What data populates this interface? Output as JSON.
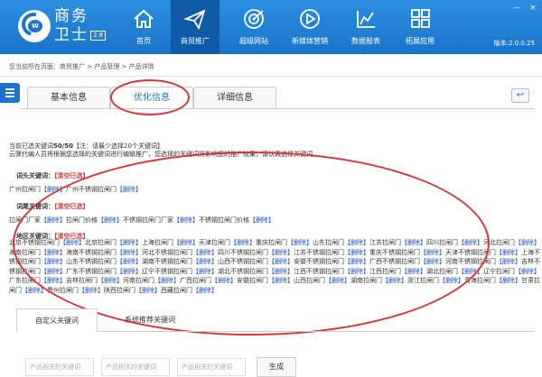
{
  "app": {
    "title": "商务卫士",
    "title_line1": "商务",
    "title_line2": "卫士",
    "version_badge": "2.8",
    "version_text": "版本:2.0.0.25"
  },
  "nav": {
    "items": [
      {
        "label": "首页",
        "icon": "home-icon"
      },
      {
        "label": "商贸推广",
        "icon": "paper-plane-icon"
      },
      {
        "label": "超级网站",
        "icon": "target-icon"
      },
      {
        "label": "新媒体营销",
        "icon": "play-icon"
      },
      {
        "label": "数据报表",
        "icon": "chart-icon"
      },
      {
        "label": "拓展应用",
        "icon": "grid-icon"
      }
    ],
    "active_index": 1
  },
  "window_controls": [
    "—",
    "×"
  ],
  "breadcrumb": "您当前所在页面：商贸推广 > 产品管理 > 产品详情",
  "tabs": [
    {
      "label": "基本信息"
    },
    {
      "label": "优化信息"
    },
    {
      "label": "详细信息"
    }
  ],
  "back_icon": "↩",
  "keywords": {
    "selected_prefix": "当前已选关键词",
    "selected_count": "50/50",
    "selected_suffix": "【注：请最少选择20个关键词】",
    "hint": "云骤代编人员将根据您选择的关键词进行编辑推广，您选择的关键词将影响您的推广效果，请认真选择关键词。",
    "clear_label": "【清空已选】",
    "delete_label": "【删除】",
    "prefix_group": {
      "label": "词头关键词：",
      "items": [
        "广州拉闸门",
        "广州不锈钢拉闸门"
      ]
    },
    "suffix_group": {
      "label": "词尾关键词：",
      "items": [
        "拉闸门厂家",
        "拉闸门价格",
        "不锈钢拉闸门厂家",
        "不锈钢拉闸门价格"
      ]
    },
    "region_group": {
      "label": "地区关键词：",
      "items": [
        "北京不锈钢拉闸门",
        "北京拉闸门",
        "上海拉闸门",
        "天津拉闸门",
        "重庆拉闸门",
        "山东拉闸门",
        "江苏拉闸门",
        "四川拉闸门",
        "河北拉闸门",
        "海南拉闸门",
        "海南不锈钢拉闸门",
        "河北不锈钢拉闸门",
        "四川不锈钢拉闸门",
        "江苏不锈钢拉闸门",
        "重庆不锈钢拉闸门",
        "天津不锈钢拉闸门",
        "上海不锈钢拉闸门",
        "山东不锈钢拉闸门",
        "湖南不锈钢拉闸门",
        "山西不锈钢拉闸门",
        "安徽不锈钢拉闸门",
        "广西不锈钢拉闸门",
        "河南不锈钢拉闸门",
        "吉林不锈钢拉闸门",
        "广东不锈钢拉闸门",
        "辽宁不锈钢拉闸门",
        "湖北不锈钢拉闸门",
        "江西不锈钢拉闸门",
        "江西拉闸门",
        "湖北拉闸门",
        "辽宁拉闸门",
        "广东拉闸门",
        "吉林拉闸门",
        "河南拉闸门",
        "广西拉闸门",
        "安徽拉闸门",
        "山西拉闸门",
        "湖南拉闸门",
        "浙江拉闸门",
        "青海拉闸门",
        "甘肃拉闸门",
        "贵州拉闸门",
        "陕西拉闸门",
        "西藏拉闸门"
      ]
    }
  },
  "sub_tabs": [
    {
      "label": "自定义关键词"
    },
    {
      "label": "系统推荐关键词"
    }
  ],
  "inputs": [
    {
      "placeholder": "产品相关的关键词"
    },
    {
      "placeholder": "产品相关的关键词"
    },
    {
      "placeholder": "产品相关的关键词"
    }
  ],
  "generate_label": "生成",
  "colors": {
    "header_blue": "#1a74c9",
    "active_nav": "#0f5ba8",
    "annotation_red": "#d9343a",
    "delete_link": "#1a4fb8"
  }
}
